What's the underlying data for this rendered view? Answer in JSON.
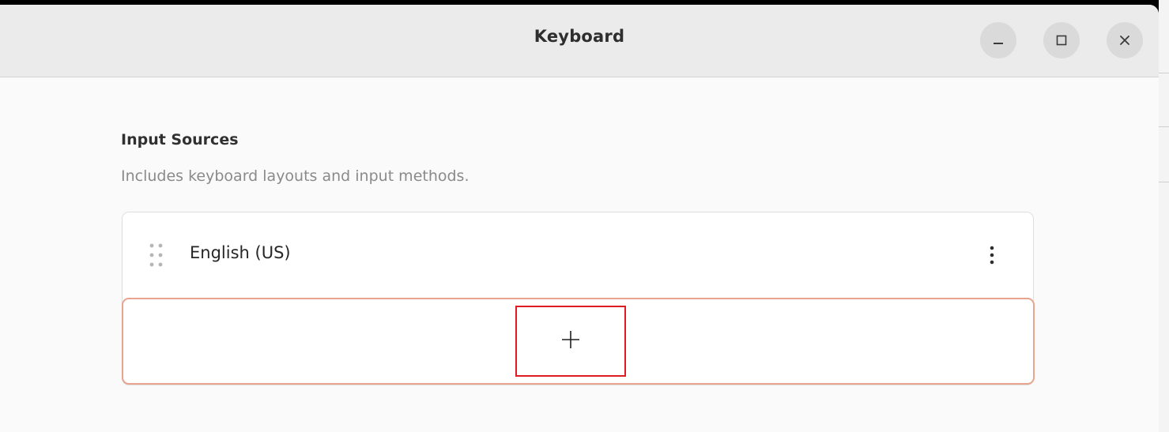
{
  "window": {
    "title": "Keyboard",
    "controls": {
      "minimize_icon": "minimize-icon",
      "maximize_icon": "maximize-icon",
      "close_icon": "close-icon"
    }
  },
  "input_sources": {
    "title": "Input Sources",
    "description": "Includes keyboard layouts and input methods.",
    "items": [
      {
        "label": "English (US)",
        "handle_icon": "drag-handle-icon",
        "menu_icon": "more-options-icon"
      }
    ],
    "add_icon": "plus-icon"
  },
  "colors": {
    "focus_border": "#e9a48e",
    "highlight_box": "#e01b24"
  }
}
